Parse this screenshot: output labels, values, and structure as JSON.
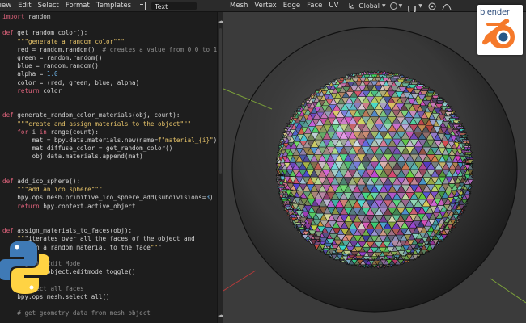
{
  "menubar": {
    "left_items": [
      "View",
      "Edit",
      "Select",
      "Format",
      "Templates"
    ],
    "text_block_name": "Text",
    "right_items": [
      "Mesh",
      "Vertex",
      "Edge",
      "Face",
      "UV"
    ],
    "transform_orientation": "Global"
  },
  "branding": {
    "blender_wordmark": "blender"
  },
  "colors": {
    "accent_orange": "#f5792a",
    "blender_blue": "#265787",
    "python_blue": "#3f7ab6",
    "python_yellow": "#ffd343"
  },
  "editor": {
    "lines": [
      "import random",
      "",
      "def get_random_color():",
      "    \"\"\"generate a random color\"\"\"",
      "    red = random.random()  # creates a value from 0.0 to 1.0",
      "    green = random.random()",
      "    blue = random.random()",
      "    alpha = 1.0",
      "    color = (red, green, blue, alpha)",
      "    return color",
      "",
      "",
      "def generate_random_color_materials(obj, count):",
      "    \"\"\"create and assign materials to the object\"\"\"",
      "    for i in range(count):",
      "        mat = bpy.data.materials.new(name=f\"material_{i}\")",
      "        mat.diffuse_color = get_random_color()",
      "        obj.data.materials.append(mat)",
      "",
      "",
      "def add_ico_sphere():",
      "    \"\"\"add an ico sphere\"\"\"",
      "    bpy.ops.mesh.primitive_ico_sphere_add(subdivisions=3)",
      "    return bpy.context.active_object",
      "",
      "",
      "def assign_materials_to_faces(obj):",
      "    \"\"\"iterates over all the faces of the object and",
      "    assign a random material to the face\"\"\"",
      "",
      "    # go to Edit Mode",
      "    bpy.ops.object.editmode_toggle()",
      "",
      "    # select all faces",
      "    bpy.ops.mesh.select_all()",
      "",
      "    # get geometry data from mesh object"
    ]
  }
}
